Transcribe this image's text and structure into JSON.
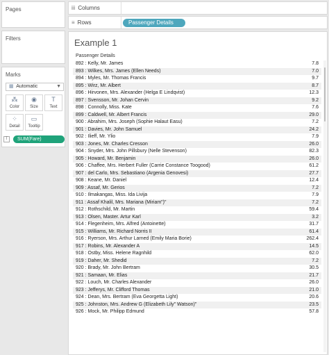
{
  "left_panel": {
    "pages": {
      "title": "Pages"
    },
    "filters": {
      "title": "Filters"
    },
    "marks": {
      "title": "Marks",
      "mark_type": "Automatic",
      "buttons": [
        {
          "label": "Color",
          "icon": "color-icon"
        },
        {
          "label": "Size",
          "icon": "size-icon"
        },
        {
          "label": "Text",
          "icon": "text-icon"
        },
        {
          "label": "Detail",
          "icon": "detail-icon"
        },
        {
          "label": "Tooltip",
          "icon": "tooltip-icon"
        }
      ],
      "text_field": "SUM(Fare)"
    }
  },
  "shelves": {
    "columns_label": "Columns",
    "rows_label": "Rows",
    "rows_pill": "Passenger Details"
  },
  "view": {
    "title": "Example 1",
    "column_header": "Passenger Details",
    "rows": [
      {
        "name": "892 : Kelly, Mr. James",
        "fare": "7.8"
      },
      {
        "name": "893 : Wilkes, Mrs. James (Ellen Needs)",
        "fare": "7.0"
      },
      {
        "name": "894 : Myles, Mr. Thomas Francis",
        "fare": "9.7"
      },
      {
        "name": "895 : Wirz, Mr. Albert",
        "fare": "8.7"
      },
      {
        "name": "896 : Hirvonen, Mrs. Alexander (Helga E Lindqvist)",
        "fare": "12.3"
      },
      {
        "name": "897 : Svensson, Mr. Johan Cervin",
        "fare": "9.2"
      },
      {
        "name": "898 : Connolly, Miss. Kate",
        "fare": "7.6"
      },
      {
        "name": "899 : Caldwell, Mr. Albert Francis",
        "fare": "29.0"
      },
      {
        "name": "900 : Abrahim, Mrs. Joseph (Sophie Halaut Easu)",
        "fare": "7.2"
      },
      {
        "name": "901 : Davies, Mr. John Samuel",
        "fare": "24.2"
      },
      {
        "name": "902 : Ilieff, Mr. Ylio",
        "fare": "7.9"
      },
      {
        "name": "903 : Jones, Mr. Charles Cresson",
        "fare": "26.0"
      },
      {
        "name": "904 : Snyder, Mrs. John Pillsbury (Nelle Stevenson)",
        "fare": "82.3"
      },
      {
        "name": "905 : Howard, Mr. Benjamin",
        "fare": "26.0"
      },
      {
        "name": "906 : Chaffee, Mrs. Herbert Fuller (Carrie Constance Toogood)",
        "fare": "61.2"
      },
      {
        "name": "907 : del Carlo, Mrs. Sebastiano (Argenia Genovesi)",
        "fare": "27.7"
      },
      {
        "name": "908 : Keane, Mr. Daniel",
        "fare": "12.4"
      },
      {
        "name": "909 : Assaf, Mr. Gerios",
        "fare": "7.2"
      },
      {
        "name": "910 : Ilmakangas, Miss. Ida Livija",
        "fare": "7.9"
      },
      {
        "name": "911 : Assaf Khalil, Mrs. Mariana (Miriam\")\"",
        "fare": "7.2"
      },
      {
        "name": "912 : Rothschild, Mr. Martin",
        "fare": "59.4"
      },
      {
        "name": "913 : Olsen, Master. Artur Karl",
        "fare": "3.2"
      },
      {
        "name": "914 : Flegenheim, Mrs. Alfred (Antoinette)",
        "fare": "31.7"
      },
      {
        "name": "915 : Williams, Mr. Richard Norris II",
        "fare": "61.4"
      },
      {
        "name": "916 : Ryerson, Mrs. Arthur Larned (Emily Maria Borie)",
        "fare": "262.4"
      },
      {
        "name": "917 : Robins, Mr. Alexander A",
        "fare": "14.5"
      },
      {
        "name": "918 : Ostby, Miss. Helene Ragnhild",
        "fare": "62.0"
      },
      {
        "name": "919 : Daher, Mr. Shedid",
        "fare": "7.2"
      },
      {
        "name": "920 : Brady, Mr. John Bertram",
        "fare": "30.5"
      },
      {
        "name": "921 : Samaan, Mr. Elias",
        "fare": "21.7"
      },
      {
        "name": "922 : Louch, Mr. Charles Alexander",
        "fare": "26.0"
      },
      {
        "name": "923 : Jefferys, Mr. Clifford Thomas",
        "fare": "21.0"
      },
      {
        "name": "924 : Dean, Mrs. Bertram (Eva Georgetta Light)",
        "fare": "20.6"
      },
      {
        "name": "925 : Johnston, Mrs. Andrew G (Elizabeth Lily\" Watson)\"",
        "fare": "23.5"
      },
      {
        "name": "926 : Mock, Mr. Philipp Edmund",
        "fare": "57.8"
      }
    ]
  }
}
